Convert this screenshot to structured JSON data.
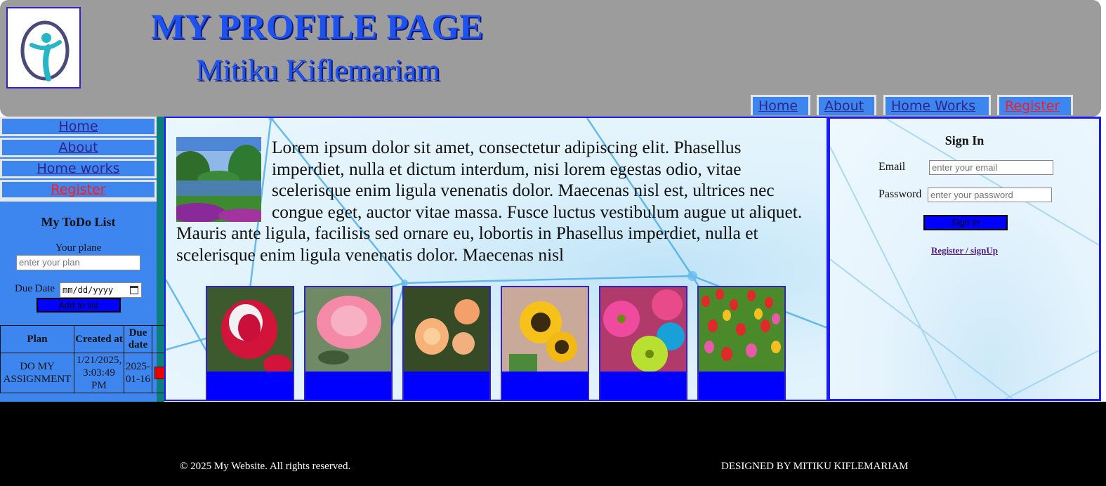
{
  "header": {
    "title": "MY PROFILE PAGE",
    "subtitle": "Mitiku Kiflemariam",
    "logo_icon": "person-logo-icon",
    "nav": [
      {
        "label": "Home"
      },
      {
        "label": "About"
      },
      {
        "label": "Home Works"
      },
      {
        "label": "Register"
      }
    ]
  },
  "sidebar": {
    "links": [
      {
        "label": "Home"
      },
      {
        "label": "About"
      },
      {
        "label": "Home works"
      },
      {
        "label": "Register"
      }
    ],
    "todo": {
      "title": "My ToDo List",
      "plan_label": "Your plane",
      "plan_placeholder": "enter your plan",
      "due_label": "Due Date",
      "due_value": "mm/dd/yyyy",
      "add_button": "Add to list",
      "columns": [
        "Plan",
        "Created at",
        "Due date"
      ],
      "rows": [
        {
          "plan": "DO MY ASSIGNMENT",
          "created": "1/21/2025, 3:03:49 PM",
          "due": "2025-01-16"
        }
      ]
    }
  },
  "main": {
    "paragraph": "Lorem ipsum dolor sit amet, consectetur adipiscing elit. Phasellus imperdiet, nulla et dictum interdum, nisi lorem egestas odio, vitae scelerisque enim ligula venenatis dolor. Maecenas nisl est, ultrices nec congue eget, auctor vitae massa. Fusce luctus vestibulum augue ut aliquet. Mauris ante ligula, facilisis sed ornare eu, lobortis in Phasellus imperdiet, nulla et scelerisque enim ligula venenatis dolor. Maecenas nisl",
    "gallery": [
      "red-rose",
      "pink-rose",
      "peach-roses",
      "sunflowers",
      "gerbera-daisies",
      "tulips"
    ]
  },
  "signin": {
    "title": "Sign In",
    "email_label": "Email",
    "email_placeholder": "enter your email",
    "password_label": "Password",
    "password_placeholder": "enter your password",
    "button": "Sign In",
    "register_link": "Register / signUp"
  },
  "footer": {
    "copyright": "© 2025 My Website. All rights reserved.",
    "credit": "DESIGNED BY MITIKU KIFLEMARIAM"
  },
  "colors": {
    "header_bg": "#9c9c9c",
    "title_blue": "#1e52ee",
    "nav_blue": "#3d86f0",
    "button_blue": "#0000ff",
    "register_red": "#ff1a1a"
  }
}
